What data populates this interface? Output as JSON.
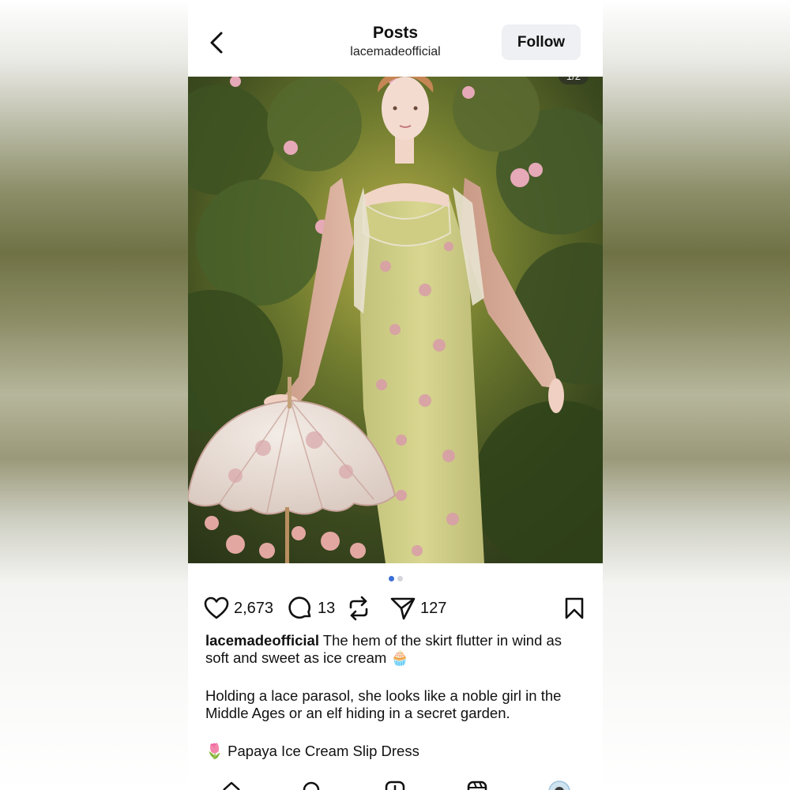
{
  "header": {
    "title": "Posts",
    "username": "lacemadeofficial",
    "follow_label": "Follow"
  },
  "post": {
    "image_counter": "1/2",
    "carousel": {
      "total": 2,
      "active": 1
    },
    "actions": {
      "likes": "2,673",
      "comments": "13",
      "shares": "127"
    },
    "caption": {
      "username": "lacemadeofficial",
      "line1": "The hem of the skirt flutter in wind as soft and sweet as ice cream 🧁",
      "line2": "Holding a lace parasol, she looks like a noble girl in the Middle Ages or an elf hiding in a secret garden.",
      "line3": "🌷 Papaya Ice Cream Slip Dress"
    }
  },
  "tabbar": {
    "icons": [
      "home-icon",
      "search-icon",
      "create-icon",
      "reels-icon",
      "profile-avatar"
    ]
  },
  "colors": {
    "accent": "#3b6fd8",
    "follow_bg": "#eef0f3",
    "text": "#111111"
  }
}
